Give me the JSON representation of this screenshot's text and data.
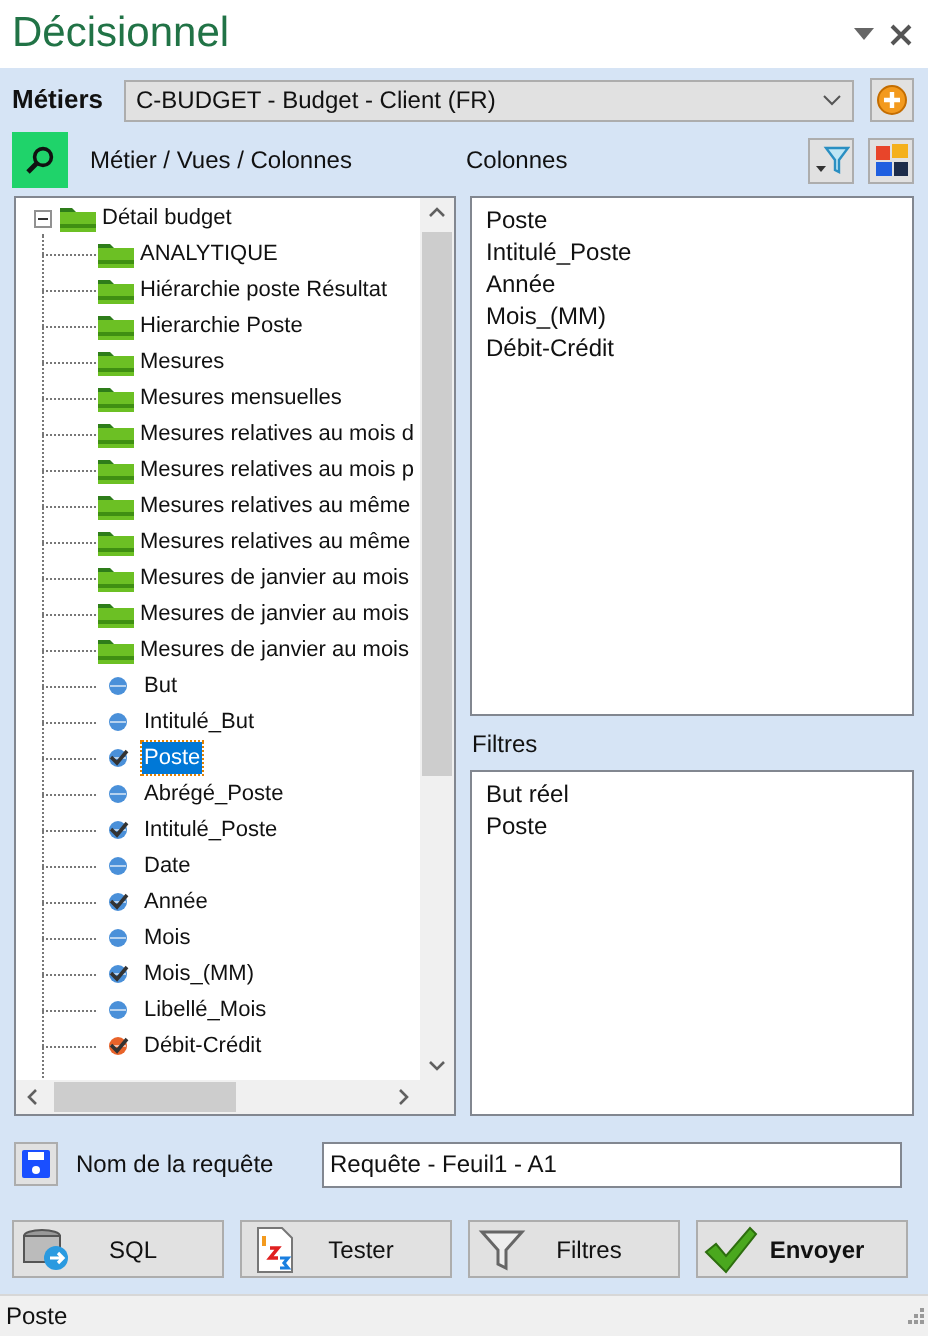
{
  "window": {
    "title": "Décisionnel"
  },
  "metiers": {
    "label": "Métiers",
    "value": "C-BUDGET - Budget - Client (FR)"
  },
  "tree_header": "Métier / Vues / Colonnes",
  "tree": [
    {
      "label": "Détail budget",
      "kind": "folder",
      "expanded": true,
      "selected": false,
      "children": [
        {
          "label": "ANALYTIQUE",
          "kind": "folder",
          "selected": false
        },
        {
          "label": "Hiérarchie poste Résultat",
          "kind": "folder",
          "selected": false
        },
        {
          "label": "Hierarchie Poste",
          "kind": "folder",
          "selected": false
        },
        {
          "label": "Mesures",
          "kind": "folder",
          "selected": false
        },
        {
          "label": "Mesures mensuelles",
          "kind": "folder",
          "selected": false
        },
        {
          "label": "Mesures relatives au mois d",
          "kind": "folder",
          "selected": false
        },
        {
          "label": "Mesures relatives au mois p",
          "kind": "folder",
          "selected": false
        },
        {
          "label": "Mesures relatives au même",
          "kind": "folder",
          "selected": false
        },
        {
          "label": "Mesures relatives au même",
          "kind": "folder",
          "selected": false
        },
        {
          "label": "Mesures de janvier au mois",
          "kind": "folder",
          "selected": false
        },
        {
          "label": "Mesures de janvier au mois",
          "kind": "folder",
          "selected": false
        },
        {
          "label": "Mesures de janvier au mois",
          "kind": "folder",
          "selected": false
        },
        {
          "label": "But",
          "kind": "field",
          "color": "#4a90d9",
          "checked": false,
          "selected": false
        },
        {
          "label": "Intitulé_But",
          "kind": "field",
          "color": "#4a90d9",
          "checked": false,
          "selected": false
        },
        {
          "label": "Poste",
          "kind": "field",
          "color": "#4a90d9",
          "checked": true,
          "selected": true
        },
        {
          "label": "Abrégé_Poste",
          "kind": "field",
          "color": "#4a90d9",
          "checked": false,
          "selected": false
        },
        {
          "label": "Intitulé_Poste",
          "kind": "field",
          "color": "#4a90d9",
          "checked": true,
          "selected": false
        },
        {
          "label": "Date",
          "kind": "field",
          "color": "#4a90d9",
          "checked": false,
          "selected": false
        },
        {
          "label": "Année",
          "kind": "field",
          "color": "#4a90d9",
          "checked": true,
          "selected": false
        },
        {
          "label": "Mois",
          "kind": "field",
          "color": "#4a90d9",
          "checked": false,
          "selected": false
        },
        {
          "label": "Mois_(MM)",
          "kind": "field",
          "color": "#4a90d9",
          "checked": true,
          "selected": false
        },
        {
          "label": "Libellé_Mois",
          "kind": "field",
          "color": "#4a90d9",
          "checked": false,
          "selected": false
        },
        {
          "label": "Débit-Crédit",
          "kind": "field",
          "color": "#e8632a",
          "checked": true,
          "selected": false
        }
      ]
    }
  ],
  "columns": {
    "label": "Colonnes",
    "items": [
      "Poste",
      "Intitulé_Poste",
      "Année",
      "Mois_(MM)",
      "Débit-Crédit"
    ]
  },
  "filters": {
    "label": "Filtres",
    "items": [
      "But réel",
      "Poste"
    ]
  },
  "query": {
    "label": "Nom de la requête",
    "value": "Requête - Feuil1 - A1"
  },
  "buttons": [
    {
      "label": "SQL",
      "kind": "sql",
      "bold": false
    },
    {
      "label": "Tester",
      "kind": "test",
      "bold": false
    },
    {
      "label": "Filtres",
      "kind": "filter",
      "bold": false
    },
    {
      "label": "Envoyer",
      "kind": "send",
      "bold": true
    }
  ],
  "status_bar": "Poste"
}
